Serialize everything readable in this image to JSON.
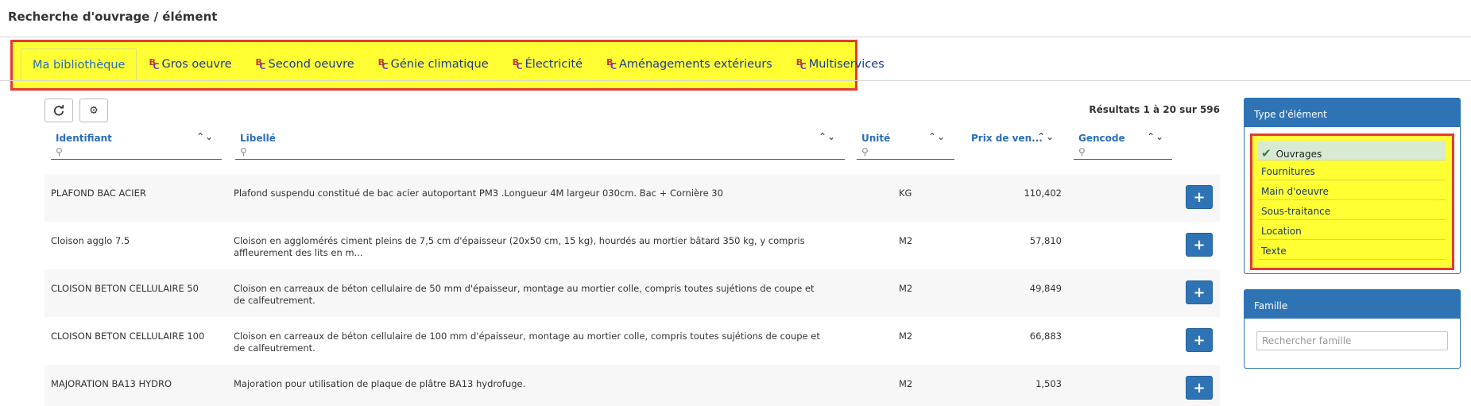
{
  "page": {
    "title": "Recherche d'ouvrage / élément"
  },
  "tabs": [
    {
      "label": "Ma bibliothèque",
      "icon": ""
    },
    {
      "label": "Gros oeuvre",
      "icon": "bc-icon"
    },
    {
      "label": "Second oeuvre",
      "icon": "bc-icon"
    },
    {
      "label": "Génie climatique",
      "icon": "bc-icon"
    },
    {
      "label": "Électricité",
      "icon": "bc-icon"
    },
    {
      "label": "Aménagements extérieurs",
      "icon": "bc-icon"
    },
    {
      "label": "Multiservices",
      "icon": "bc-icon"
    }
  ],
  "toolbar": {
    "refresh_icon": "refresh-icon",
    "settings_icon": "gear-icon"
  },
  "results": {
    "text": "Résultats 1 à 20 sur 596"
  },
  "table": {
    "columns": [
      {
        "label": "Identifiant",
        "sort": "⌃⌄"
      },
      {
        "label": "Libellé",
        "sort": "⌃⌄"
      },
      {
        "label": "Unité",
        "sort": "⌃⌄"
      },
      {
        "label": "Prix de ven...",
        "sort": "⌃⌄"
      },
      {
        "label": "Gencode",
        "sort": "⌃⌄"
      }
    ],
    "rows": [
      {
        "id": "PLAFOND BAC ACIER",
        "libelle": "Plafond suspendu constitué de bac acier autoportant PM3 .Longueur 4M largeur 030cm. Bac + Cornière 30",
        "unite": "KG",
        "prix": "110,402",
        "add": "+"
      },
      {
        "id": "Cloison agglo 7.5",
        "libelle": "Cloison en agglomérés ciment pleins de 7,5 cm d'épaisseur (20x50 cm, 15 kg), hourdés au mortier bâtard 350 kg, y compris affleurement des lits en m...",
        "unite": "M2",
        "prix": "57,810",
        "add": "+"
      },
      {
        "id": "CLOISON BETON CELLULAIRE 50",
        "libelle": "Cloison en carreaux de béton cellulaire de 50 mm d'épaisseur, montage au mortier colle, compris toutes sujétions de coupe et de calfeutrement.",
        "unite": "M2",
        "prix": "49,849",
        "add": "+"
      },
      {
        "id": "CLOISON BETON CELLULAIRE 100",
        "libelle": "Cloison en carreaux de béton cellulaire de 100 mm d'épaisseur, montage au mortier colle, compris toutes sujétions de coupe et de calfeutrement.",
        "unite": "M2",
        "prix": "66,883",
        "add": "+"
      },
      {
        "id": "MAJORATION BA13 HYDRO",
        "libelle": "Majoration pour utilisation de plaque de plâtre BA13 hydrofuge.",
        "unite": "M2",
        "prix": "1,503",
        "add": "+"
      }
    ]
  },
  "type_panel": {
    "title": "Type d'élément",
    "items": [
      "Ouvrages",
      "Fournitures",
      "Main d'oeuvre",
      "Sous-traitance",
      "Location",
      "Texte"
    ],
    "selected_mark": "✔"
  },
  "famille_panel": {
    "title": "Famille",
    "placeholder": "Rechercher famille"
  },
  "colors": {
    "accent": "#2e74b5",
    "highlight": "#ffff33",
    "highlight_border": "#e53935",
    "selected_bg": "#d9ead3"
  }
}
